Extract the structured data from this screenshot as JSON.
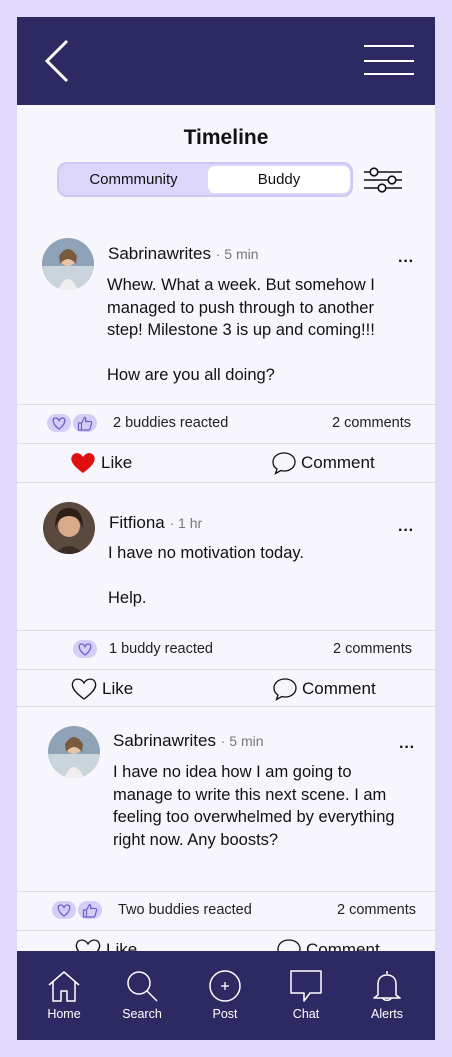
{
  "header": {
    "title": "Timeline"
  },
  "tabs": {
    "community": "Commmunity",
    "buddy": "Buddy"
  },
  "posts": [
    {
      "author": "Sabrinawrites",
      "time": "· 5 min",
      "text": "Whew. What a week. But somehow I\nmanaged to push through to another\nstep! Milestone 3 is up and coming!!!\n\nHow are you all doing?",
      "reactions": "2 buddies reacted",
      "comments": "2 comments",
      "like_label": "Like",
      "comment_label": "Comment",
      "liked": true
    },
    {
      "author": "Fitfiona",
      "time": "· 1 hr",
      "text": "I have no motivation today.\n\nHelp.",
      "reactions": "1 buddy reacted",
      "comments": "2 comments",
      "like_label": "Like",
      "comment_label": "Comment",
      "liked": false
    },
    {
      "author": "Sabrinawrites",
      "time": "· 5 min",
      "text": "I have no idea how I am going to\nmanage to write this next scene. I am\nfeeling too overwhelmed by everything\nright now. Any boosts?",
      "reactions": "Two buddies reacted",
      "comments": "2 comments",
      "like_label": "Like",
      "comment_label": "Comment",
      "liked": false
    }
  ],
  "nav": [
    {
      "label": "Home",
      "icon": "home-icon"
    },
    {
      "label": "Search",
      "icon": "search-icon"
    },
    {
      "label": "Post",
      "icon": "plus-circle-icon"
    },
    {
      "label": "Chat",
      "icon": "chat-icon"
    },
    {
      "label": "Alerts",
      "icon": "bell-icon"
    }
  ],
  "colors": {
    "frame": "#e2dafc",
    "bar": "#2d2a63",
    "accent": "#d4cdf7",
    "like_red": "#e01010"
  }
}
